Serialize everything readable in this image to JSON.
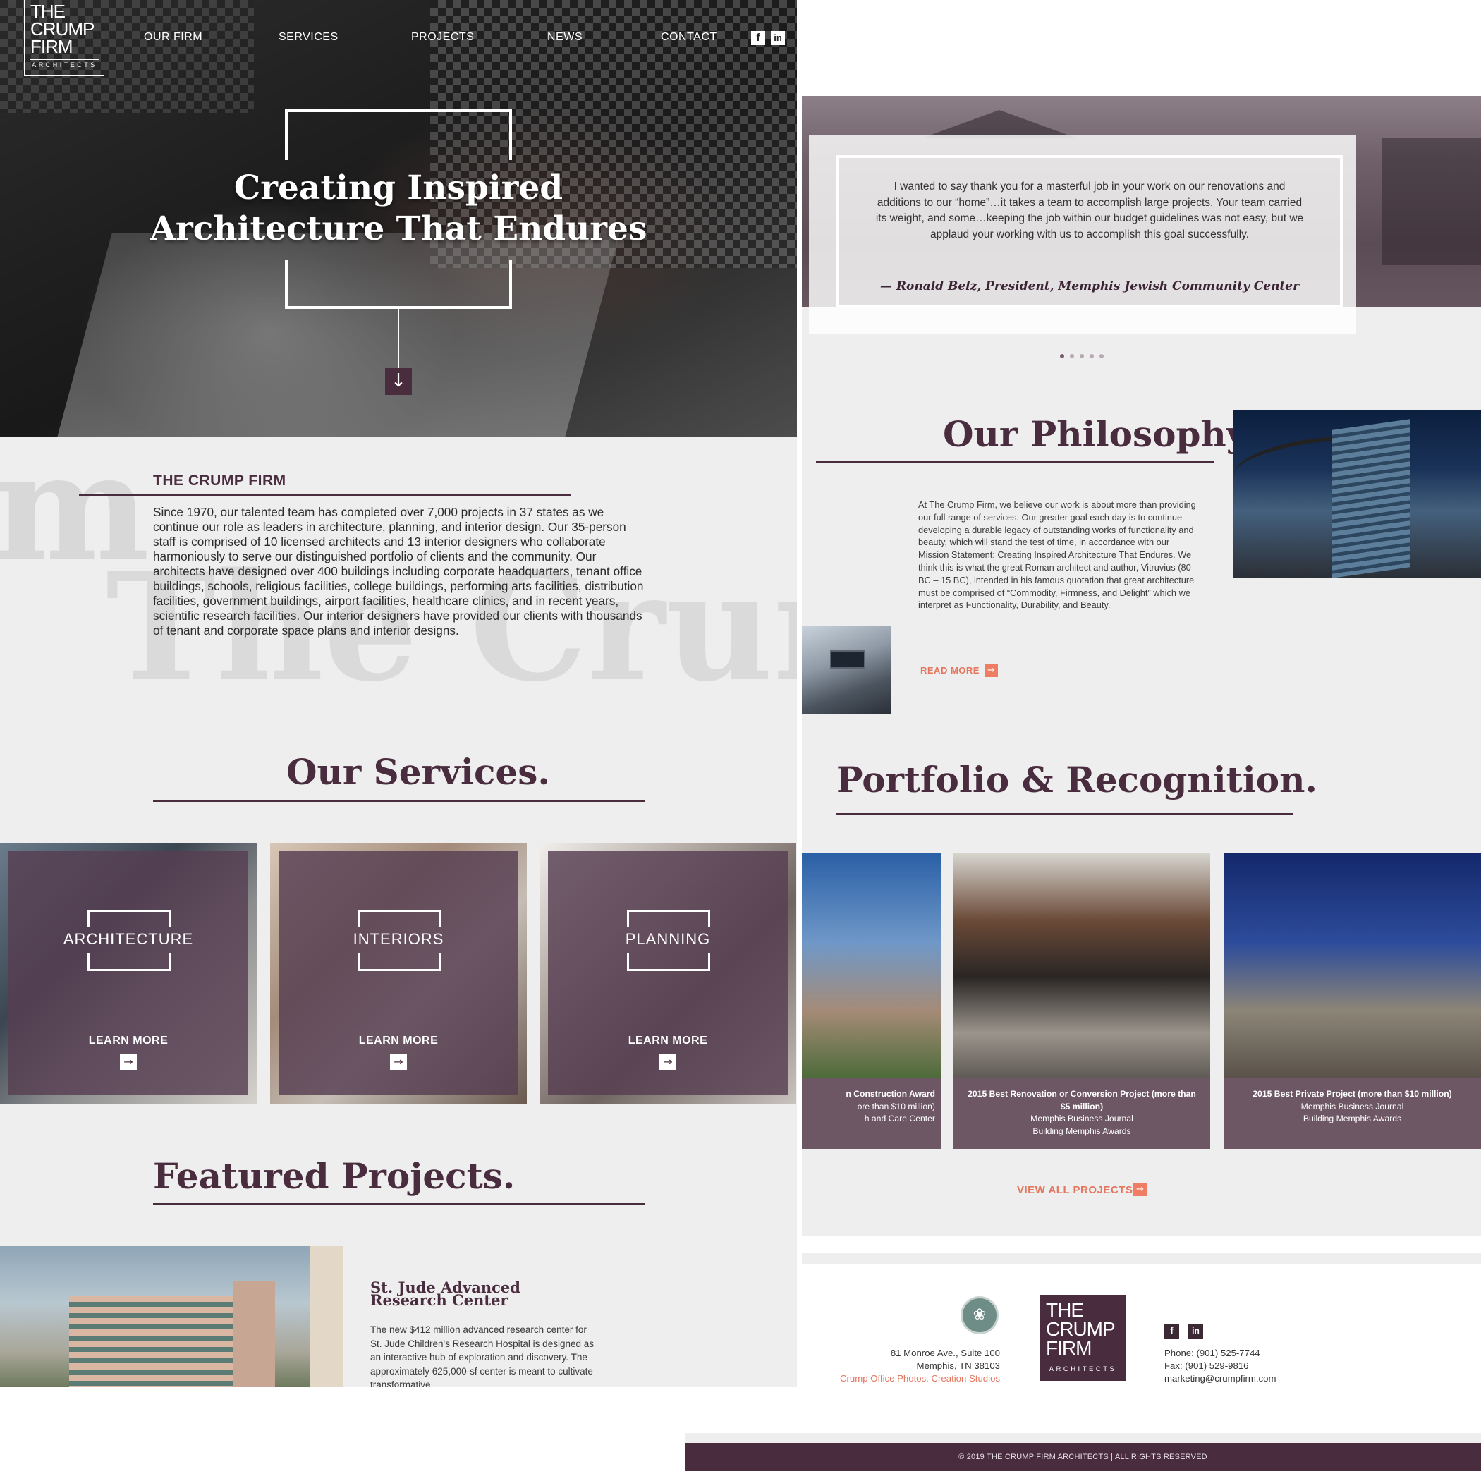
{
  "brand": {
    "logo_line1": "THE",
    "logo_line2": "CRUMP",
    "logo_line3": "FIRM",
    "logo_sub": "ARCHITECTS",
    "color_primary": "#4a2c3f",
    "color_accent": "#ef7d63"
  },
  "nav": {
    "items": [
      {
        "label": "OUR FIRM"
      },
      {
        "label": "SERVICES"
      },
      {
        "label": "PROJECTS"
      },
      {
        "label": "NEWS"
      },
      {
        "label": "CONTACT"
      }
    ],
    "social": [
      {
        "icon": "facebook-icon",
        "glyph": "f"
      },
      {
        "icon": "linkedin-icon",
        "glyph": "in"
      }
    ]
  },
  "hero": {
    "title_line1": "Creating Inspired",
    "title_line2": "Architecture That Endures",
    "scroll_icon": "arrow-down-icon",
    "scroll_glyph": "↓"
  },
  "about": {
    "watermark_1": "m",
    "watermark_2": "The Crum",
    "heading": "THE CRUMP FIRM",
    "body": "Since 1970, our talented team has completed over 7,000 projects in 37 states as we continue our role as leaders in architecture, planning, and interior design. Our 35-person staff is comprised of 10 licensed architects and 13 interior designers who collaborate harmoniously to serve our distinguished portfolio of clients and the community. Our architects have designed over 400 buildings including corporate headquarters, tenant office buildings, schools, religious facilities, college buildings, performing arts facilities, distribution facilities, government buildings, airport facilities, healthcare clinics, and in recent years, scientific research facilities. Our interior designers have provided our clients with thousands of tenant and corporate space plans and interior designs."
  },
  "services": {
    "title": "Our Services.",
    "cards": [
      {
        "label": "ARCHITECTURE",
        "cta": "LEARN MORE"
      },
      {
        "label": "INTERIORS",
        "cta": "LEARN MORE"
      },
      {
        "label": "PLANNING",
        "cta": "LEARN MORE"
      }
    ],
    "arrow_glyph": "→"
  },
  "featured": {
    "title": "Featured Projects.",
    "project_title": "St. Jude Advanced Research Center",
    "project_body": "The new $412 million advanced research center for St. Jude Children's Research Hospital is designed as an interactive hub of exploration and discovery. The approximately 625,000-sf center is meant to cultivate transformative"
  },
  "testimonial": {
    "quote": "I wanted to say thank you for a masterful job in your work on our renovations and additions to our “home”…it takes a team to accomplish large projects. Your team carried its weight, and some…keeping the job within our budget guidelines was not easy, but we applaud your working with us to accomplish this goal successfully.",
    "author": "— Ronald Belz, President, Memphis Jewish Community Center",
    "slides": 5,
    "active_slide": 1
  },
  "philosophy": {
    "title": "Our Philosophy.",
    "body": "At The Crump Firm, we believe our work is about more than providing our full range of services. Our greater goal each day is to continue developing a durable legacy of outstanding works of functionality and beauty, which will stand the test of time, in accordance with our Mission Statement: Creating Inspired Architecture That Endures. We think this is what the great Roman architect and author, Vitruvius (80 BC – 15 BC), intended in his famous quotation that great architecture must be comprised of “Commodity, Firmness, and Delight” which we interpret as Functionality, Durability, and Beauty.",
    "cta": "READ MORE"
  },
  "portfolio": {
    "title": "Portfolio & Recognition.",
    "cards": [
      {
        "award": "n Construction Award",
        "lines": [
          "ore than $10 million)",
          "h and Care Center"
        ]
      },
      {
        "award": "2015 Best Renovation or Conversion Project (more than $5 million)",
        "lines": [
          "Memphis Business Journal",
          "Building Memphis Awards"
        ]
      },
      {
        "award": "2015 Best Private Project (more than $10 million)",
        "lines": [
          "Memphis Business Journal",
          "Building Memphis Awards"
        ]
      }
    ],
    "cta": "VIEW ALL PROJECTS"
  },
  "footer": {
    "seal_icon": "usgbc-member-seal-icon",
    "seal_glyph": "❀",
    "address_line1": "81 Monroe Ave., Suite 100",
    "address_line2": "Memphis, TN 38103",
    "photo_credit": "Crump Office Photos: Creation Studios",
    "phone": "Phone: (901) 525-7744",
    "fax": "Fax: (901) 529-9816",
    "email": "marketing@crumpfirm.com",
    "copyright": "© 2019 THE CRUMP FIRM ARCHITECTS   |   ALL RIGHTS RESERVED"
  }
}
